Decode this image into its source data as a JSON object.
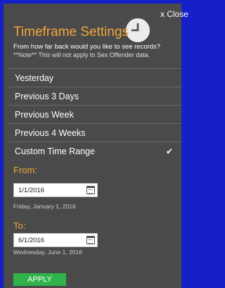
{
  "dialog": {
    "close_label": "x Close",
    "clock_icon": "clock-icon",
    "title": "Timeframe Settings",
    "subtitle": "From how far back would you like to see records?",
    "note": "**Note** This will not apply to Sex Offender data."
  },
  "options": [
    {
      "label": "Yesterday",
      "selected": false
    },
    {
      "label": "Previous 3 Days",
      "selected": false
    },
    {
      "label": "Previous Week",
      "selected": false
    },
    {
      "label": "Previous 4 Weeks",
      "selected": false
    },
    {
      "label": "Custom Time Range",
      "selected": true
    }
  ],
  "check_mark": "✔",
  "from": {
    "label": "From:",
    "value": "1/1/2016",
    "hint": "Friday, January 1, 2016"
  },
  "to": {
    "label": "To:",
    "value": "6/1/2016",
    "hint": "Wednesday, June 1, 2016"
  },
  "apply_label": "APPLY",
  "colors": {
    "background": "#1520c8",
    "panel": "#4a4a4a",
    "accent": "#f0a63a",
    "apply": "#2fb34a"
  }
}
